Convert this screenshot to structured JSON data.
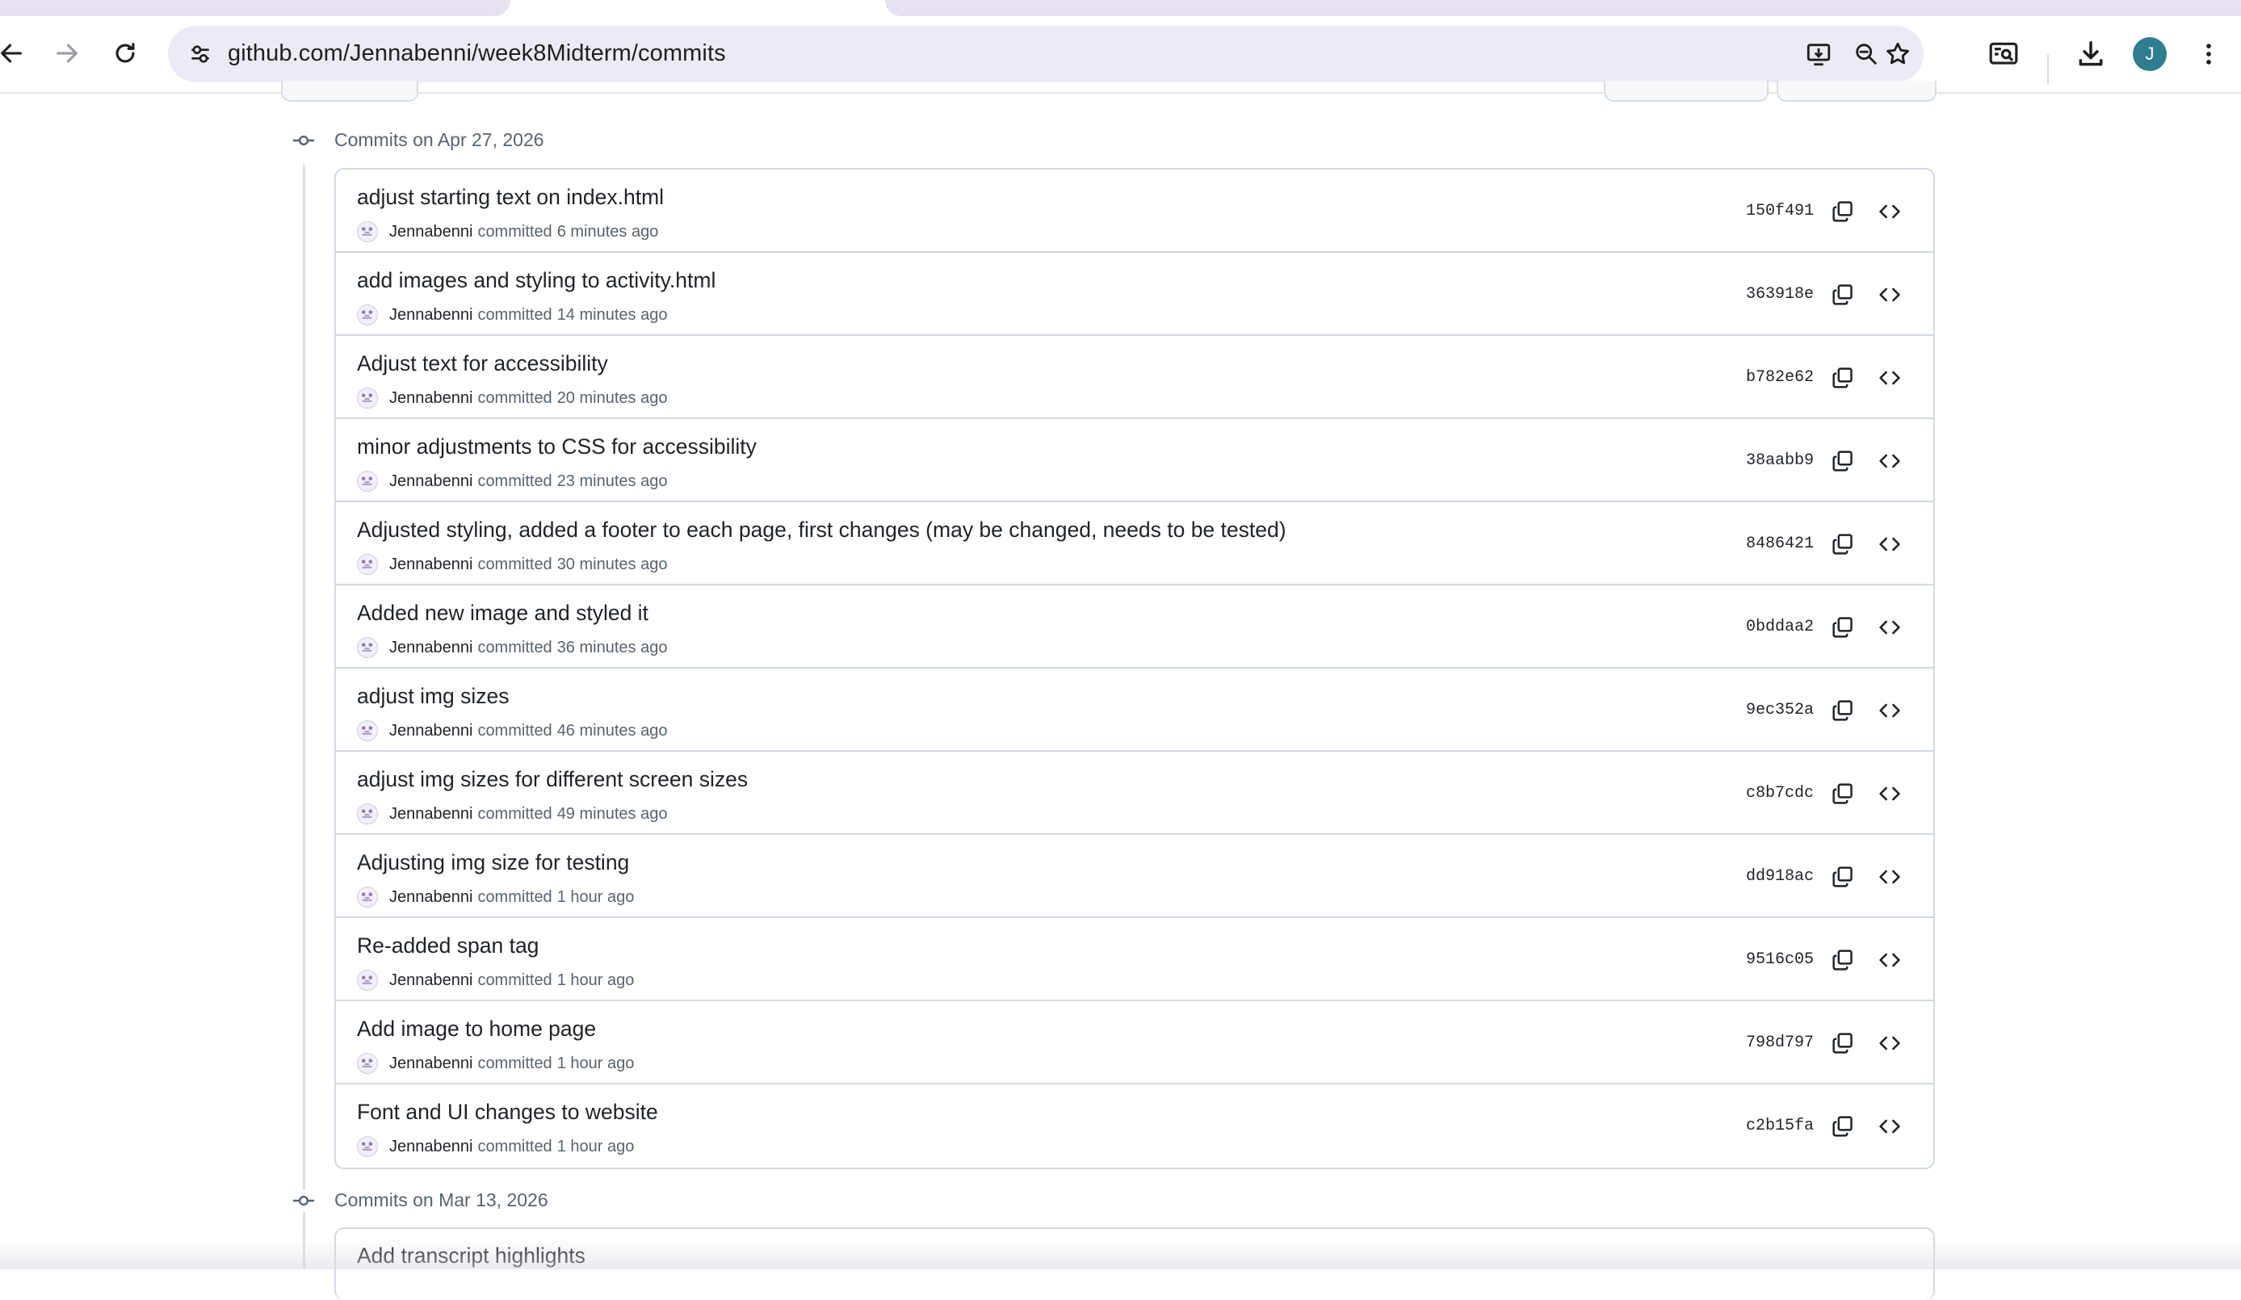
{
  "browser": {
    "url": "github.com/Jennabenni/week8Midterm/commits",
    "profile_initial": "J"
  },
  "icons": {
    "back": "arrow-left-icon",
    "forward": "arrow-right-icon",
    "reload": "reload-icon",
    "site_info": "tune-icon",
    "install": "install-app-icon",
    "zoom": "zoom-icon",
    "bookmark": "star-icon",
    "lens": "search-screen-icon",
    "download": "download-icon",
    "menu": "kebab-menu-icon",
    "commit_node": "git-commit-icon",
    "copy": "copy-icon",
    "browse": "code-icon"
  },
  "colors": {
    "accent_tab": "#e7e1f1",
    "omnibox": "#eeeaf4",
    "profile": "#2f7d8e",
    "border": "#d1d9e0",
    "muted_text": "#59636e"
  },
  "groups": [
    {
      "heading": "Commits on Apr 27, 2026",
      "commits": [
        {
          "title": "adjust starting text on index.html",
          "author": "Jennabenni",
          "verb": "committed",
          "time": "6 minutes ago",
          "sha": "150f491"
        },
        {
          "title": "add images and styling to activity.html",
          "author": "Jennabenni",
          "verb": "committed",
          "time": "14 minutes ago",
          "sha": "363918e"
        },
        {
          "title": "Adjust text for accessibility",
          "author": "Jennabenni",
          "verb": "committed",
          "time": "20 minutes ago",
          "sha": "b782e62"
        },
        {
          "title": "minor adjustments to CSS for accessibility",
          "author": "Jennabenni",
          "verb": "committed",
          "time": "23 minutes ago",
          "sha": "38aabb9"
        },
        {
          "title": "Adjusted styling, added a footer to each page, first changes (may be changed, needs to be tested)",
          "author": "Jennabenni",
          "verb": "committed",
          "time": "30 minutes ago",
          "sha": "8486421"
        },
        {
          "title": "Added new image and styled it",
          "author": "Jennabenni",
          "verb": "committed",
          "time": "36 minutes ago",
          "sha": "0bddaa2"
        },
        {
          "title": "adjust img sizes",
          "author": "Jennabenni",
          "verb": "committed",
          "time": "46 minutes ago",
          "sha": "9ec352a"
        },
        {
          "title": "adjust img sizes for different screen sizes",
          "author": "Jennabenni",
          "verb": "committed",
          "time": "49 minutes ago",
          "sha": "c8b7cdc"
        },
        {
          "title": "Adjusting img size for testing",
          "author": "Jennabenni",
          "verb": "committed",
          "time": "1 hour ago",
          "sha": "dd918ac"
        },
        {
          "title": "Re-added span tag",
          "author": "Jennabenni",
          "verb": "committed",
          "time": "1 hour ago",
          "sha": "9516c05"
        },
        {
          "title": "Add image to home page",
          "author": "Jennabenni",
          "verb": "committed",
          "time": "1 hour ago",
          "sha": "798d797"
        },
        {
          "title": "Font and UI changes to website",
          "author": "Jennabenni",
          "verb": "committed",
          "time": "1 hour ago",
          "sha": "c2b15fa"
        }
      ]
    },
    {
      "heading": "Commits on Mar 13, 2026",
      "commits": [
        {
          "title": "Add transcript highlights"
        }
      ]
    }
  ]
}
